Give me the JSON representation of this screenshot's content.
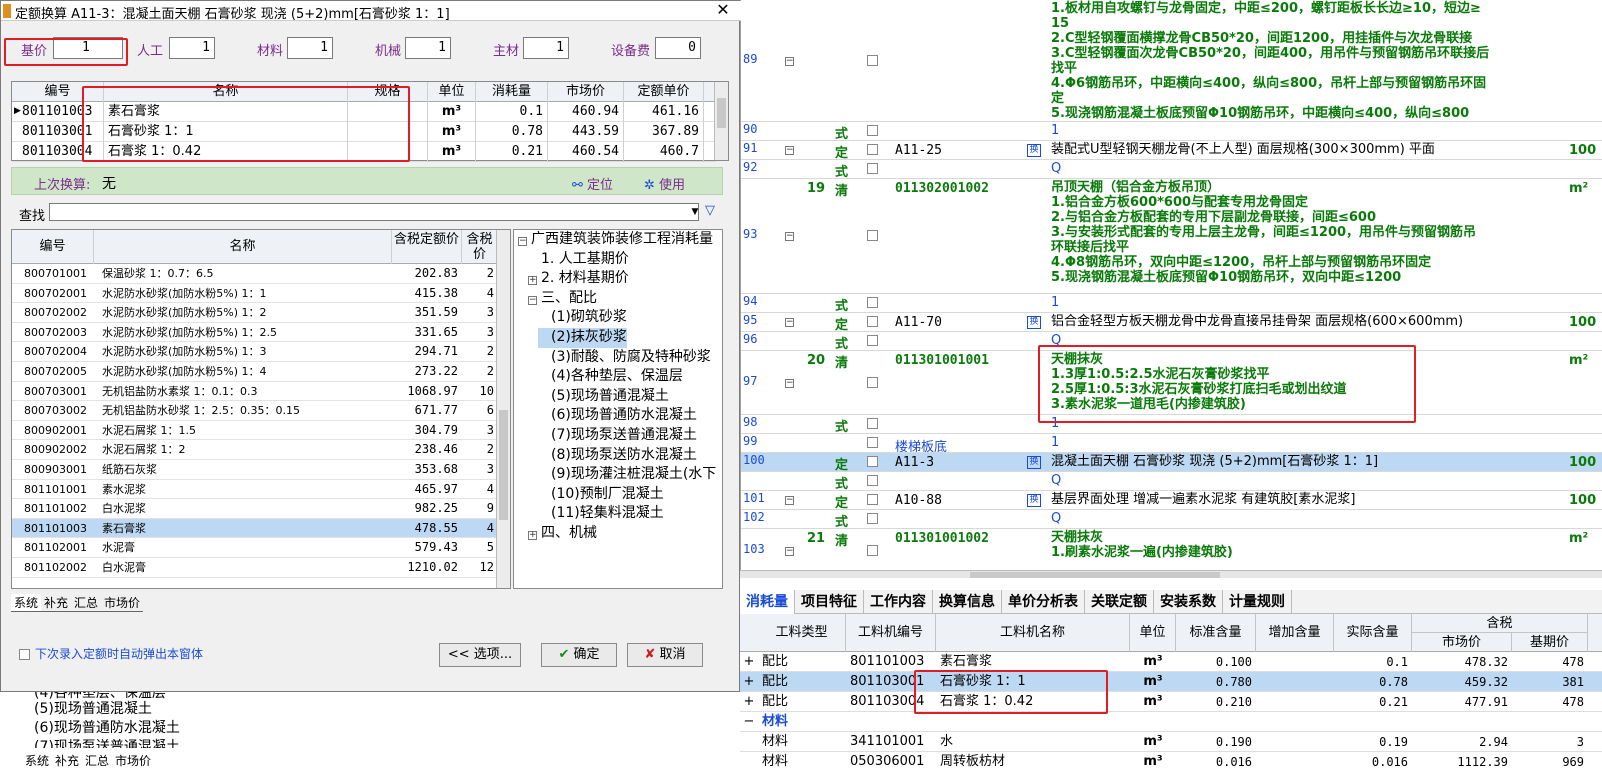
{
  "dialog": {
    "title": "定额换算   A11-3：混凝土面天棚 石膏砂浆 现浇 (5+2)mm[石膏砂浆 1：1]",
    "close": "✕",
    "coef": [
      {
        "label": "基价",
        "value": "1"
      },
      {
        "label": "人工",
        "value": "1"
      },
      {
        "label": "材料",
        "value": "1"
      },
      {
        "label": "机械",
        "value": "1"
      },
      {
        "label": "主材",
        "value": "1"
      },
      {
        "label": "设备费",
        "value": "0"
      }
    ],
    "upper_headers": [
      "编号",
      "名称",
      "规格",
      "单位",
      "消耗量",
      "市场价",
      "定额单价"
    ],
    "upper_rows": [
      {
        "code": "801101003",
        "name": "素石膏浆",
        "spec": "",
        "unit": "m³",
        "qty": "0.1",
        "market": "460.94",
        "unitprice": "461.16"
      },
      {
        "code": "801103001",
        "name": "石膏砂浆 1：1",
        "spec": "",
        "unit": "m³",
        "qty": "0.78",
        "market": "443.59",
        "unitprice": "367.89"
      },
      {
        "code": "801103004",
        "name": "石膏浆 1：0.42",
        "spec": "",
        "unit": "m³",
        "qty": "0.21",
        "market": "460.54",
        "unitprice": "460.7"
      }
    ],
    "last_label": "上次换算:",
    "last_value": "无",
    "locate": "定位",
    "use": "使用",
    "search_label": "查找",
    "lower_headers": [
      "编号",
      "名称",
      "含税定额价",
      "含税价"
    ],
    "lower_rows": [
      {
        "code": "800701001",
        "name": "保温砂浆 1：0.7：6.5",
        "price": "202.83",
        "tax": "2"
      },
      {
        "code": "800702001",
        "name": "水泥防水砂浆(加防水粉5%) 1：1",
        "price": "415.38",
        "tax": "4"
      },
      {
        "code": "800702002",
        "name": "水泥防水砂浆(加防水粉5%) 1：2",
        "price": "351.59",
        "tax": "3"
      },
      {
        "code": "800702003",
        "name": "水泥防水砂浆(加防水粉5%) 1：2.5",
        "price": "331.65",
        "tax": "3"
      },
      {
        "code": "800702004",
        "name": "水泥防水砂浆(加防水粉5%) 1：3",
        "price": "294.71",
        "tax": "2"
      },
      {
        "code": "800702005",
        "name": "水泥防水砂浆(加防水粉5%) 1：4",
        "price": "273.22",
        "tax": "2"
      },
      {
        "code": "800703001",
        "name": "无机铝盐防水素浆 1：0.1：0.3",
        "price": "1068.97",
        "tax": "10"
      },
      {
        "code": "800703002",
        "name": "无机铝盐防水砂浆 1：2.5：0.35：0.15",
        "price": "671.77",
        "tax": "6"
      },
      {
        "code": "800902001",
        "name": "水泥石屑浆 1：1.5",
        "price": "304.79",
        "tax": "3"
      },
      {
        "code": "800902002",
        "name": "水泥石屑浆 1：2",
        "price": "238.46",
        "tax": "2"
      },
      {
        "code": "800903001",
        "name": "纸筋石灰浆",
        "price": "353.68",
        "tax": "3"
      },
      {
        "code": "801101001",
        "name": "素水泥浆",
        "price": "465.97",
        "tax": "4"
      },
      {
        "code": "801101002",
        "name": "白水泥浆",
        "price": "982.25",
        "tax": "9"
      },
      {
        "code": "801101003",
        "name": "素石膏浆",
        "price": "478.55",
        "tax": "4"
      },
      {
        "code": "801102001",
        "name": "水泥膏",
        "price": "579.43",
        "tax": "5"
      },
      {
        "code": "801102002",
        "name": "白水泥膏",
        "price": "1210.02",
        "tax": "12"
      }
    ],
    "tree": [
      {
        "label": "广西建筑装饰装修工程消耗量",
        "exp": "−",
        "indent": 0
      },
      {
        "label": "1. 人工基期价",
        "exp": "",
        "indent": 1
      },
      {
        "label": "2. 材料基期价",
        "exp": "+",
        "indent": 1
      },
      {
        "label": "三、配比",
        "exp": "−",
        "indent": 1
      },
      {
        "label": "(1)砌筑砂浆",
        "exp": "",
        "indent": 2
      },
      {
        "label": "(2)抹灰砂浆",
        "exp": "",
        "indent": 2
      },
      {
        "label": "(3)耐酸、防腐及特种砂浆",
        "exp": "",
        "indent": 2
      },
      {
        "label": "(4)各种垫层、保温层",
        "exp": "",
        "indent": 2
      },
      {
        "label": "(5)现场普通混凝土",
        "exp": "",
        "indent": 2
      },
      {
        "label": "(6)现场普通防水混凝土",
        "exp": "",
        "indent": 2
      },
      {
        "label": "(7)现场泵送普通混凝土",
        "exp": "",
        "indent": 2
      },
      {
        "label": "(8)现场泵送防水混凝土",
        "exp": "",
        "indent": 2
      },
      {
        "label": "(9)现场灌注桩混凝土(水下",
        "exp": "",
        "indent": 2
      },
      {
        "label": "(10)预制厂混凝土",
        "exp": "",
        "indent": 2
      },
      {
        "label": "(11)轻集料混凝土",
        "exp": "",
        "indent": 2
      },
      {
        "label": "四、机械",
        "exp": "+",
        "indent": 1
      }
    ],
    "subtabs": [
      "系统",
      "补充",
      "汇总",
      "市场价"
    ],
    "auto_popup": "下次录入定额时自动弹出本窗体",
    "options_btn": "<< 选项...",
    "ok_btn": "确定",
    "cancel_btn": "取消"
  },
  "behind_panel": {
    "items": [
      "(4)各种垫层、保温层",
      "(5)现场普通混凝土",
      "(6)现场普通防水混凝土",
      "(7)现场泵送普通混凝土"
    ],
    "tabs": [
      "系统",
      "补充",
      "汇总",
      "市场价"
    ]
  },
  "grid": {
    "rows": [
      {
        "no": "89",
        "exp": "−",
        "num": "",
        "type": "",
        "code": "",
        "flag": "",
        "unit": "",
        "lines": [
          "1.板材用自攻螺钉与龙骨固定，中距≤200，螺钉距板长长边≥10，短边≥",
          "15",
          "2.C型轻钢覆面横撑龙骨CB50*20，间距1200，用挂插件与次龙骨联接",
          "3.C型轻钢覆面次龙骨CB50*20，间距400，用吊件与预留钢筋吊环联接后",
          "找平",
          "4.Φ6钢筋吊环，中距横向≤400，纵向≤800，吊杆上部与预留钢筋吊环固",
          "定",
          "5.现浇钢筋混凝土板底预留Φ10钢筋吊环，中距横向≤400，纵向≤800"
        ],
        "green": true
      },
      {
        "no": "90",
        "exp": "",
        "num": "",
        "type": "式",
        "code": "",
        "flag": "",
        "unit": "",
        "lines": [
          "1"
        ],
        "blue": true
      },
      {
        "no": "91",
        "exp": "−",
        "num": "",
        "type": "定",
        "code": "A11-25",
        "flag": "换",
        "unit": "100",
        "lines": [
          "装配式U型轻钢天棚龙骨(不上人型) 面层规格(300×300mm)  平面"
        ]
      },
      {
        "no": "92",
        "exp": "",
        "num": "",
        "type": "式",
        "code": "",
        "flag": "",
        "unit": "",
        "lines": [
          "Q"
        ],
        "blue": true
      },
      {
        "no": "93",
        "exp": "−",
        "num": "19",
        "type": "清",
        "code": "011302001002",
        "flag": "",
        "unit": "m²",
        "lines": [
          "吊顶天棚（铝合金方板吊顶）",
          "1.铝合金方板600*600与配套专用龙骨固定",
          "2.与铝合金方板配套的专用下层副龙骨联接，间距≤600",
          "3.与安装形式配套的专用上层主龙骨，间距≤1200，用吊件与预留钢筋吊",
          "环联接后找平",
          "4.Φ8钢筋吊环，双向中距≤1200，吊杆上部与预留钢筋吊环固定",
          "5.现浇钢筋混凝土板底预留Φ10钢筋吊环，双向中距≤1200"
        ],
        "green": true
      },
      {
        "no": "94",
        "exp": "",
        "num": "",
        "type": "式",
        "code": "",
        "flag": "",
        "unit": "",
        "lines": [
          "1"
        ],
        "blue": true
      },
      {
        "no": "95",
        "exp": "−",
        "num": "",
        "type": "定",
        "code": "A11-70",
        "flag": "换",
        "unit": "100",
        "lines": [
          "铝合金轻型方板天棚龙骨中龙骨直接吊挂骨架 面层规格(600×600mm)"
        ]
      },
      {
        "no": "96",
        "exp": "",
        "num": "",
        "type": "式",
        "code": "",
        "flag": "",
        "unit": "",
        "lines": [
          "Q"
        ],
        "blue": true
      },
      {
        "no": "97",
        "exp": "−",
        "num": "20",
        "type": "清",
        "code": "011301001001",
        "flag": "",
        "unit": "m²",
        "lines": [
          "天棚抹灰",
          "1.3厚1:0.5:2.5水泥石灰膏砂浆找平",
          "2.5厚1:0.5:3水泥石灰膏砂浆打底扫毛或划出纹道",
          "3.素水泥浆一道甩毛(内掺建筑胶)"
        ],
        "green": true
      },
      {
        "no": "98",
        "exp": "",
        "num": "",
        "type": "式",
        "code": "",
        "flag": "",
        "unit": "",
        "lines": [
          "1"
        ],
        "blue": true
      },
      {
        "no": "99",
        "exp": "",
        "num": "",
        "type": "",
        "code": "楼梯板底",
        "flag": "",
        "unit": "",
        "lines": [
          "1"
        ],
        "blue": true
      },
      {
        "no": "100",
        "exp": "",
        "num": "",
        "type": "定",
        "code": "A11-3",
        "flag": "换",
        "unit": "100",
        "lines": [
          "混凝土面天棚 石膏砂浆 现浇 (5+2)mm[石膏砂浆 1：1]"
        ],
        "sel": true
      },
      {
        "no": "",
        "exp": "",
        "num": "",
        "type": "式",
        "code": "",
        "flag": "",
        "unit": "",
        "lines": [
          "Q"
        ],
        "blue": true
      },
      {
        "no": "101",
        "exp": "−",
        "num": "",
        "type": "定",
        "code": "A10-88",
        "flag": "换",
        "unit": "100",
        "lines": [
          "基层界面处理 增减一遍素水泥浆 有建筑胶[素水泥浆]"
        ]
      },
      {
        "no": "102",
        "exp": "",
        "num": "",
        "type": "式",
        "code": "",
        "flag": "",
        "unit": "",
        "lines": [
          "Q"
        ],
        "blue": true
      },
      {
        "no": "103",
        "exp": "−",
        "num": "21",
        "type": "清",
        "code": "011301001002",
        "flag": "",
        "unit": "m²",
        "lines": [
          "天棚抹灰",
          "1.刷素水泥浆一遍(内掺建筑胶)"
        ],
        "green": true
      }
    ]
  },
  "bottom_tabs": [
    "消耗量",
    "项目特征",
    "工作内容",
    "换算信息",
    "单价分析表",
    "关联定额",
    "安装系数",
    "计量规则"
  ],
  "consumption": {
    "headers": [
      "工料类型",
      "工料机编号",
      "工料机名称",
      "单位",
      "标准含量",
      "增加含量",
      "实际含量"
    ],
    "tax_header": "含税",
    "tax_sub": [
      "市场价",
      "基期价"
    ],
    "rows": [
      {
        "exp": "+",
        "type": "配比",
        "code": "801101003",
        "name": "素石膏浆",
        "unit": "m³",
        "std": "0.100",
        "add": "",
        "real": "0.1",
        "market": "478.32",
        "base": "478",
        "sel": false
      },
      {
        "exp": "+",
        "type": "配比",
        "code": "801103001",
        "name": "石膏砂浆 1：1",
        "unit": "m³",
        "std": "0.780",
        "add": "",
        "real": "0.78",
        "market": "459.32",
        "base": "381",
        "sel": true
      },
      {
        "exp": "+",
        "type": "配比",
        "code": "801103004",
        "name": "石膏浆 1：0.42",
        "unit": "m³",
        "std": "0.210",
        "add": "",
        "real": "0.21",
        "market": "477.91",
        "base": "478",
        "sel": false
      },
      {
        "exp": "−",
        "type": "材料",
        "code": "",
        "name": "",
        "unit": "",
        "std": "",
        "add": "",
        "real": "",
        "market": "",
        "base": "",
        "group": true
      },
      {
        "exp": "",
        "type": "材料",
        "code": "341101001",
        "name": "水",
        "unit": "m³",
        "std": "0.190",
        "add": "",
        "real": "0.19",
        "market": "2.94",
        "base": "3",
        "sel": false
      },
      {
        "exp": "",
        "type": "材料",
        "code": "050306001",
        "name": "周转板枋材",
        "unit": "m³",
        "std": "0.016",
        "add": "",
        "real": "0.016",
        "market": "1112.39",
        "base": "969",
        "sel": false
      }
    ]
  }
}
